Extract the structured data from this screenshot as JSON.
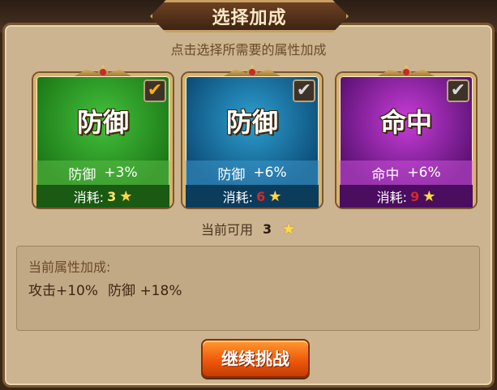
{
  "dialog": {
    "title": "选择加成",
    "subtitle": "点击选择所需要的属性加成"
  },
  "cards": [
    {
      "name": "防御",
      "stat_label": "防御",
      "stat_value": "+3%",
      "cost_label": "消耗:",
      "cost": "3",
      "cost_state": "ok",
      "selected": true,
      "color": "#2e9a25"
    },
    {
      "name": "防御",
      "stat_label": "防御",
      "stat_value": "+6%",
      "cost_label": "消耗:",
      "cost": "6",
      "cost_state": "insufficient",
      "selected": false,
      "color": "#1b78a8"
    },
    {
      "name": "命中",
      "stat_label": "命中",
      "stat_value": "+6%",
      "cost_label": "消耗:",
      "cost": "9",
      "cost_state": "insufficient",
      "selected": false,
      "color": "#9a22b0"
    }
  ],
  "available": {
    "label": "当前可用",
    "value": "3"
  },
  "bonus": {
    "title": "当前属性加成:",
    "items": [
      {
        "label": "攻击",
        "value": "+10%"
      },
      {
        "label": "防御",
        "value": "+18%"
      }
    ]
  },
  "continue_button": {
    "label": "继续挑战",
    "color": "#ef5a0b"
  },
  "icons": {
    "star": "star-icon",
    "check": "checkmark-icon"
  }
}
